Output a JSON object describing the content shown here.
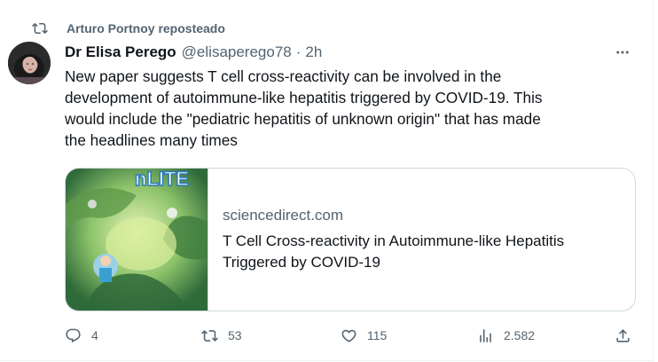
{
  "repost": {
    "label": "Arturo Portnoy reposteado",
    "icon": "repost-icon"
  },
  "author": {
    "name": "Dr Elisa Perego",
    "handle": "@elisaperego78",
    "separator": "·",
    "time": "2h"
  },
  "tweet": {
    "lines": [
      "New paper suggests T cell cross-reactivity can be involved in the",
      "development of autoimmune-like hepatitis triggered by COVID-19. This",
      "would include the \"pediatric hepatitis of unknown origin\" that has made",
      "the headlines many times"
    ]
  },
  "card": {
    "image_text": "nLITE",
    "domain": "sciencedirect.com",
    "title_lines": [
      "T Cell Cross-reactivity in Autoimmune-like Hepatitis",
      "Triggered by COVID-19"
    ]
  },
  "actions": {
    "reply_count": "4",
    "repost_count": "53",
    "like_count": "115",
    "views_count": "2.582"
  },
  "colors": {
    "text": "#0f1419",
    "secondary": "#536471",
    "border": "#cfd9de"
  }
}
